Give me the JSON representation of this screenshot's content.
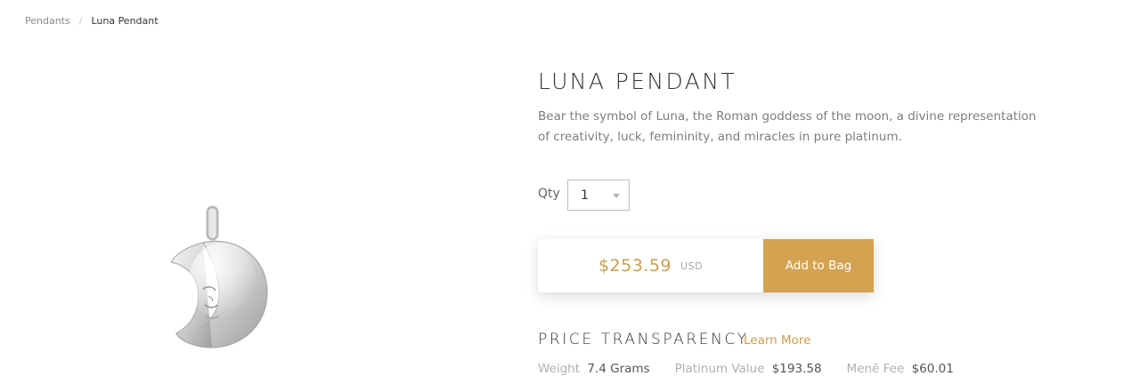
{
  "breadcrumb": {
    "parent": "Pendants",
    "separator": "/",
    "current": "Luna Pendant"
  },
  "product": {
    "title": "LUNA PENDANT",
    "description": "Bear the symbol of Luna, the Roman goddess of the moon, a divine representation of creativity, luck, femininity, and miracles in pure platinum.",
    "image_icon": "crescent-moon-pendant"
  },
  "quantity": {
    "label": "Qty",
    "value": "1"
  },
  "purchase": {
    "price": "$253.59",
    "currency": "USD",
    "add_label": "Add to Bag"
  },
  "price_transparency": {
    "heading": "PRICE TRANSPARENCY",
    "learn_more": "Learn More",
    "metrics": [
      {
        "label": "Weight",
        "value": "7.4 Grams"
      },
      {
        "label": "Platinum Value",
        "value": "$193.58"
      },
      {
        "label": "Menē Fee",
        "value": "$60.01"
      }
    ]
  },
  "colors": {
    "accent": "#d3a352",
    "price": "#c9a04c"
  }
}
